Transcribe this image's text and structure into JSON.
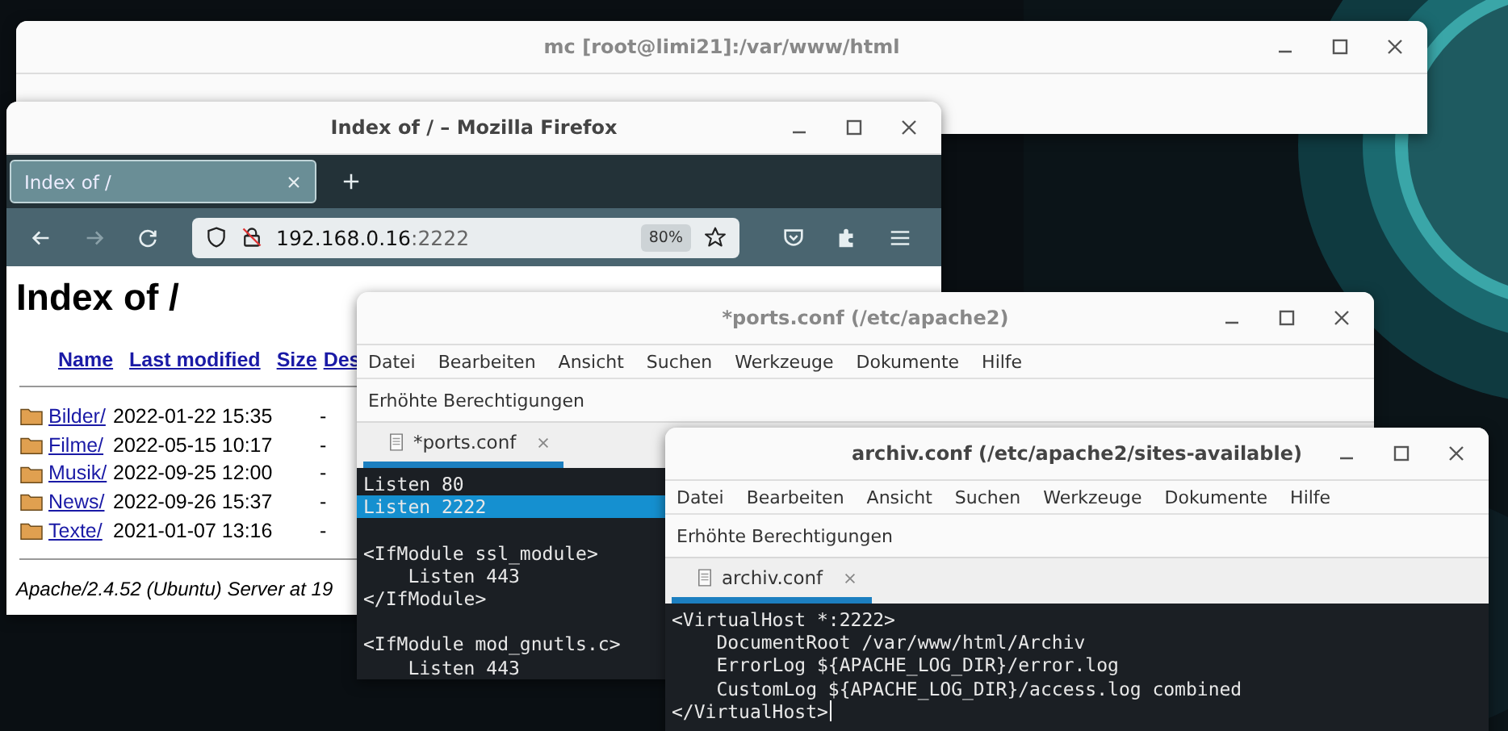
{
  "terminal_window": {
    "title": "mc [root@limi21]:/var/www/html"
  },
  "browser_window": {
    "title": "Index of / – Mozilla Firefox",
    "tabs": [
      {
        "label": "Index of /",
        "selected": true
      }
    ],
    "url_host": "192.168.0.16",
    "url_port": ":2222",
    "zoom": "80%",
    "page": {
      "heading": "Index of /",
      "columns": [
        "Name",
        "Last modified",
        "Size",
        "Des"
      ],
      "rows": [
        {
          "name": "Bilder/",
          "modified": "2022-01-22 15:35",
          "size": "-"
        },
        {
          "name": "Filme/",
          "modified": "2022-05-15 10:17",
          "size": "-"
        },
        {
          "name": "Musik/",
          "modified": "2022-09-25 12:00",
          "size": "-"
        },
        {
          "name": "News/",
          "modified": "2022-09-26 15:37",
          "size": "-"
        },
        {
          "name": "Texte/",
          "modified": "2021-01-07 13:16",
          "size": "-"
        }
      ],
      "footer": "Apache/2.4.52 (Ubuntu) Server at 19"
    }
  },
  "editor_windows": [
    {
      "title": "*ports.conf (/etc/apache2)",
      "menu": [
        "Datei",
        "Bearbeiten",
        "Ansicht",
        "Suchen",
        "Werkzeuge",
        "Dokumente",
        "Hilfe"
      ],
      "infobar": "Erhöhte Berechtigungen",
      "tabs": [
        {
          "label": "*ports.conf",
          "selected": true
        }
      ],
      "blocks": [
        [
          {
            "text": "Listen 80",
            "selected": false
          },
          {
            "text": "Listen 2222",
            "selected": true
          }
        ],
        [
          {
            "text": "<IfModule ssl_module>",
            "selected": false
          },
          {
            "text": "    Listen 443",
            "selected": false
          },
          {
            "text": "</IfModule>",
            "selected": false
          }
        ],
        [
          {
            "text": "<IfModule mod_gnutls.c>",
            "selected": false
          },
          {
            "text": "    Listen 443",
            "selected": false
          }
        ]
      ]
    },
    {
      "title": "archiv.conf (/etc/apache2/sites-available)",
      "menu": [
        "Datei",
        "Bearbeiten",
        "Ansicht",
        "Suchen",
        "Werkzeuge",
        "Dokumente",
        "Hilfe"
      ],
      "infobar": "Erhöhte Berechtigungen",
      "tabs": [
        {
          "label": "archiv.conf",
          "selected": true
        }
      ],
      "blocks": [
        [
          {
            "text": "<VirtualHost *:2222>",
            "cursor": false
          },
          {
            "text": "    DocumentRoot /var/www/html/Archiv",
            "cursor": false
          },
          {
            "text": "    ErrorLog ${APACHE_LOG_DIR}/error.log",
            "cursor": false
          },
          {
            "text": "    CustomLog ${APACHE_LOG_DIR}/access.log combined",
            "cursor": false
          },
          {
            "text": "</VirtualHost>",
            "cursor": true
          }
        ]
      ]
    }
  ]
}
